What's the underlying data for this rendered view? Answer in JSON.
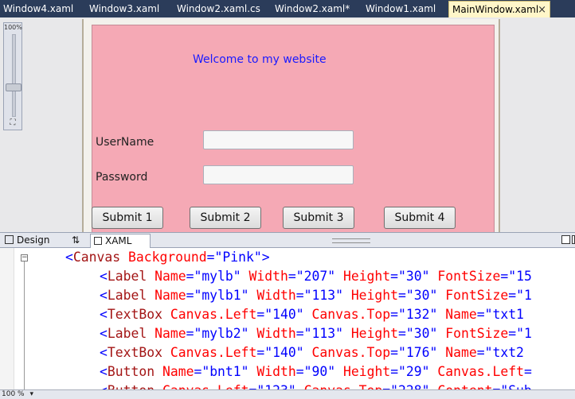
{
  "tabs": [
    {
      "label": "Window4.xaml",
      "active": false
    },
    {
      "label": "Window3.xaml",
      "active": false
    },
    {
      "label": "Window2.xaml.cs",
      "active": false
    },
    {
      "label": "Window2.xaml*",
      "active": false
    },
    {
      "label": "Window1.xaml",
      "active": false
    },
    {
      "label": "MainWindow.xaml",
      "active": true
    }
  ],
  "tab_close_glyph": "×",
  "zoom": {
    "percent": "100%",
    "level": 1.0
  },
  "design": {
    "canvas_background": "#f5a9b5",
    "welcome_text": "Welcome to my website",
    "welcome_color": "#1a1aff",
    "username_label": "UserName",
    "password_label": "Password",
    "username_value": "",
    "password_value": "",
    "buttons": [
      "Submit 1",
      "Submit 2",
      "Submit 3",
      "Submit 4"
    ]
  },
  "view_tabs": {
    "design": "Design",
    "swap": "⇅",
    "xaml": "XAML"
  },
  "code": {
    "lines": [
      [
        {
          "t": "<",
          "c": "br"
        },
        {
          "t": "Canvas",
          "c": "tag"
        },
        {
          "t": " ",
          "c": "br"
        },
        {
          "t": "Background",
          "c": "attr"
        },
        {
          "t": "=\"Pink\">",
          "c": "val"
        }
      ],
      [
        {
          "t": "<",
          "c": "br"
        },
        {
          "t": "Label",
          "c": "tag"
        },
        {
          "t": " ",
          "c": "br"
        },
        {
          "t": "Name",
          "c": "attr"
        },
        {
          "t": "=\"mylb\" ",
          "c": "val"
        },
        {
          "t": "Width",
          "c": "attr"
        },
        {
          "t": "=\"207\" ",
          "c": "val"
        },
        {
          "t": "Height",
          "c": "attr"
        },
        {
          "t": "=\"30\" ",
          "c": "val"
        },
        {
          "t": "FontSize",
          "c": "attr"
        },
        {
          "t": "=\"15",
          "c": "val"
        }
      ],
      [
        {
          "t": "<",
          "c": "br"
        },
        {
          "t": "Label",
          "c": "tag"
        },
        {
          "t": " ",
          "c": "br"
        },
        {
          "t": "Name",
          "c": "attr"
        },
        {
          "t": "=\"mylb1\" ",
          "c": "val"
        },
        {
          "t": "Width",
          "c": "attr"
        },
        {
          "t": "=\"113\" ",
          "c": "val"
        },
        {
          "t": "Height",
          "c": "attr"
        },
        {
          "t": "=\"30\" ",
          "c": "val"
        },
        {
          "t": "FontSize",
          "c": "attr"
        },
        {
          "t": "=\"1",
          "c": "val"
        }
      ],
      [
        {
          "t": "<",
          "c": "br"
        },
        {
          "t": "TextBox",
          "c": "tag"
        },
        {
          "t": " ",
          "c": "br"
        },
        {
          "t": "Canvas.Left",
          "c": "attr"
        },
        {
          "t": "=\"140\" ",
          "c": "val"
        },
        {
          "t": "Canvas.Top",
          "c": "attr"
        },
        {
          "t": "=\"132\" ",
          "c": "val"
        },
        {
          "t": "Name",
          "c": "attr"
        },
        {
          "t": "=\"txt1",
          "c": "val"
        }
      ],
      [
        {
          "t": "<",
          "c": "br"
        },
        {
          "t": "Label",
          "c": "tag"
        },
        {
          "t": " ",
          "c": "br"
        },
        {
          "t": "Name",
          "c": "attr"
        },
        {
          "t": "=\"mylb2\" ",
          "c": "val"
        },
        {
          "t": "Width",
          "c": "attr"
        },
        {
          "t": "=\"113\" ",
          "c": "val"
        },
        {
          "t": "Height",
          "c": "attr"
        },
        {
          "t": "=\"30\" ",
          "c": "val"
        },
        {
          "t": "FontSize",
          "c": "attr"
        },
        {
          "t": "=\"1",
          "c": "val"
        }
      ],
      [
        {
          "t": "<",
          "c": "br"
        },
        {
          "t": "TextBox",
          "c": "tag"
        },
        {
          "t": " ",
          "c": "br"
        },
        {
          "t": "Canvas.Left",
          "c": "attr"
        },
        {
          "t": "=\"140\" ",
          "c": "val"
        },
        {
          "t": "Canvas.Top",
          "c": "attr"
        },
        {
          "t": "=\"176\" ",
          "c": "val"
        },
        {
          "t": "Name",
          "c": "attr"
        },
        {
          "t": "=\"txt2",
          "c": "val"
        }
      ],
      [
        {
          "t": "<",
          "c": "br"
        },
        {
          "t": "Button",
          "c": "tag"
        },
        {
          "t": " ",
          "c": "br"
        },
        {
          "t": "Name",
          "c": "attr"
        },
        {
          "t": "=\"bnt1\" ",
          "c": "val"
        },
        {
          "t": "Width",
          "c": "attr"
        },
        {
          "t": "=\"90\" ",
          "c": "val"
        },
        {
          "t": "Height",
          "c": "attr"
        },
        {
          "t": "=\"29\" ",
          "c": "val"
        },
        {
          "t": "Canvas.Left",
          "c": "attr"
        },
        {
          "t": "=",
          "c": "val"
        }
      ],
      [
        {
          "t": "<",
          "c": "br"
        },
        {
          "t": "Button",
          "c": "tag"
        },
        {
          "t": " ",
          "c": "br"
        },
        {
          "t": "Canvas.Left",
          "c": "attr"
        },
        {
          "t": "=\"123\" ",
          "c": "val"
        },
        {
          "t": "Canvas.Top",
          "c": "attr"
        },
        {
          "t": "=\"228\" ",
          "c": "val"
        },
        {
          "t": "Content",
          "c": "attr"
        },
        {
          "t": "=\"Sub",
          "c": "val"
        }
      ]
    ]
  },
  "status": {
    "zoom": "100 %"
  }
}
